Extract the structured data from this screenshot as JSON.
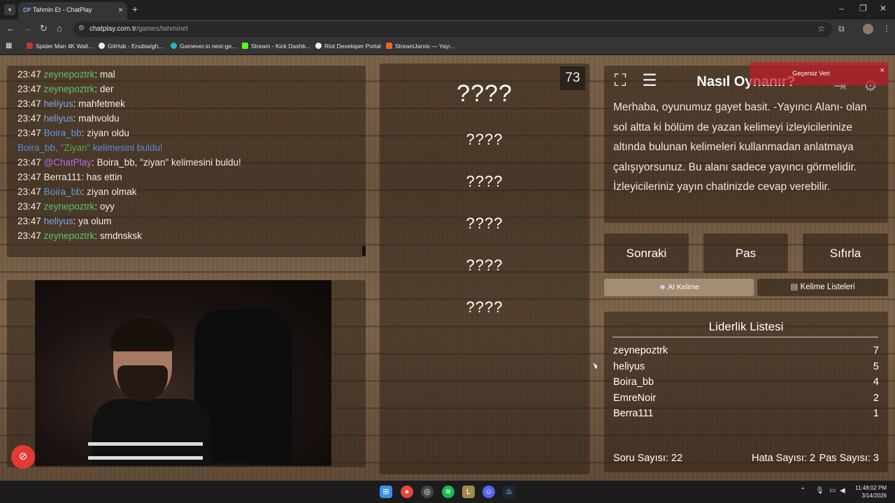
{
  "browser": {
    "tab_title": "Tahmin Et - ChatPlay",
    "tab_favicon": "CP",
    "url_host": "chatplay.com.tr",
    "url_path": "/games/tahminet",
    "bookmarks": [
      {
        "label": "Spider Man 4K Wall...",
        "icon": "4K",
        "color": "#c0392b"
      },
      {
        "label": "GitHub - Enubia/gh...",
        "icon": "github-icon",
        "color": "#eeeeee"
      },
      {
        "label": "Gamever.io next-ge...",
        "icon": "gamever-icon",
        "color": "#27b3c9"
      },
      {
        "label": "Stream - Kick Dashb...",
        "icon": "kick-icon",
        "color": "#53fc18"
      },
      {
        "label": "Riot Developer Portal",
        "icon": "riot-icon",
        "color": "#eeeeee"
      },
      {
        "label": "StreamJarvis — Yayı...",
        "icon": "jarvis-icon",
        "color": "#e8642c"
      }
    ]
  },
  "chat": {
    "lines": [
      {
        "time": "23:47",
        "user": "zeynepoztrk",
        "color": "#5bc46e",
        "msg": ": mal"
      },
      {
        "time": "23:47",
        "user": "zeynepoztrk",
        "color": "#5bc46e",
        "msg": ": der"
      },
      {
        "time": "23:47",
        "user": "heliyus",
        "color": "#7aa6e6",
        "msg": ": mahfetmek"
      },
      {
        "time": "23:47",
        "user": "heliyus",
        "color": "#7aa6e6",
        "msg": ": mahvoldu"
      },
      {
        "time": "23:47",
        "user": "Boira_bb",
        "color": "#5aa0e0",
        "msg": ": ziyan oldu"
      },
      {
        "time": "23:47",
        "user": "@ChatPlay",
        "color": "#b46fe6",
        "msg": ": Boira_bb, \"ziyan\" kelimesini buldu!"
      },
      {
        "time": "23:47",
        "user": "Berra111",
        "color": "#f2ece6",
        "msg": ": has ettin"
      },
      {
        "time": "23:47",
        "user": "Boira_bb",
        "color": "#5aa0e0",
        "msg": ": ziyan olmak"
      },
      {
        "time": "23:47",
        "user": "zeynepoztrk",
        "color": "#5bc46e",
        "msg": ": oyy"
      },
      {
        "time": "23:47",
        "user": "heliyus",
        "color": "#7aa6e6",
        "msg": ": ya olum"
      },
      {
        "time": "23:47",
        "user": "zeynepoztrk",
        "color": "#5bc46e",
        "msg": ": smdnsksk"
      }
    ],
    "system": {
      "before": "Boira_bb, \"",
      "word": "Ziyan",
      "after": "\" kelimesini buldu!"
    }
  },
  "words": {
    "timer": "73",
    "main": "????",
    "alternatives": [
      "????",
      "????",
      "????",
      "????",
      "????"
    ]
  },
  "howto": {
    "title": "Nasıl Oynanır?",
    "text": "Merhaba, oyunumuz gayet basit. -Yayıncı Alanı- olan sol altta ki bölüm de yazan kelimeyi izleyicilerinize altında bulunan kelimeleri kullanmadan anlatmaya çalışıyorsunuz. Bu alanı sadece yayıncı görmelidir. İzleyicileriniz yayın chatinizde cevap verebilir."
  },
  "toast": {
    "text": "Geçersiz Veri",
    "close": "×"
  },
  "controls": {
    "next": "Sonraki",
    "pass": "Pas",
    "reset": "Sıfırla",
    "ai_word": "AI Kelime",
    "word_lists": "Kelime Listeleri"
  },
  "leaderboard": {
    "title": "Liderlik Listesi",
    "rows": [
      {
        "name": "zeynepoztrk",
        "score": "7"
      },
      {
        "name": "heliyus",
        "score": "5"
      },
      {
        "name": "Boira_bb",
        "score": "4"
      },
      {
        "name": "EmreNoir",
        "score": "2"
      },
      {
        "name": "Berra111",
        "score": "1"
      }
    ],
    "question_count": "Soru Sayısı: 22",
    "error_count": "Hata Sayısı: 2",
    "pass_count": "Pas Sayısı: 3"
  },
  "taskbar": {
    "time": "11:48:02 PM",
    "date": "3/14/2026"
  }
}
